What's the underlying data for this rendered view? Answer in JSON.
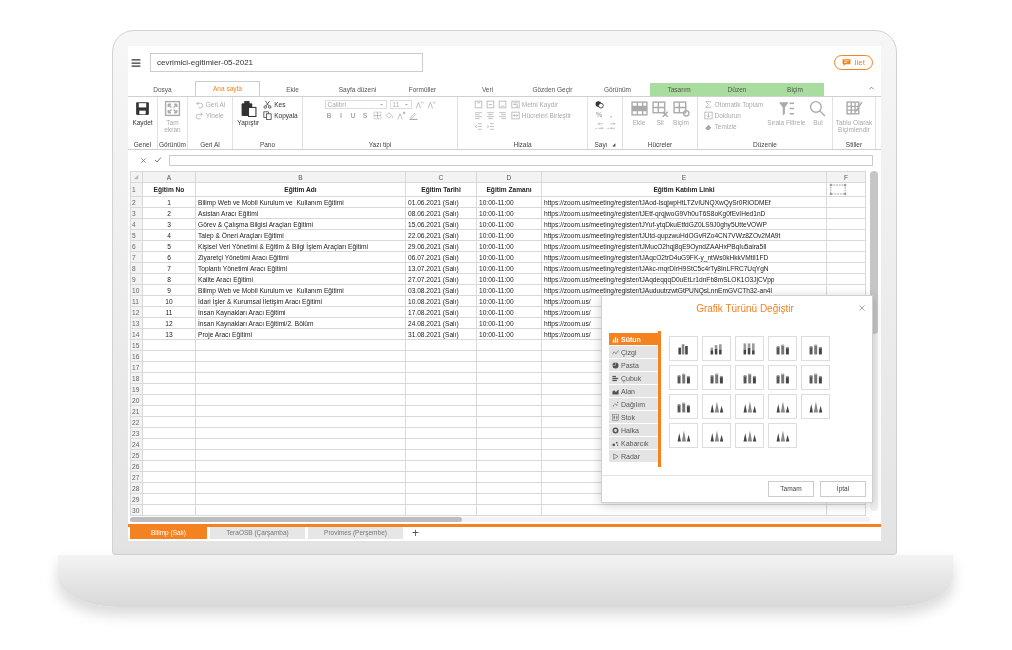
{
  "top_bar": {
    "file_name": "cevrimici-egitimler-05-2021",
    "feedback_button": "İlet"
  },
  "ribbon_tabs": [
    {
      "label": "Dosya",
      "selected": false,
      "kind": "standard"
    },
    {
      "label": "Ana sayfa",
      "selected": true,
      "kind": "standard"
    },
    {
      "label": "Ekle",
      "selected": false,
      "kind": "standard"
    },
    {
      "label": "Sayfa düzeni",
      "selected": false,
      "kind": "standard"
    },
    {
      "label": "Formüller",
      "selected": false,
      "kind": "standard"
    },
    {
      "label": "Veri",
      "selected": false,
      "kind": "standard"
    },
    {
      "label": "Gözden Geçir",
      "selected": false,
      "kind": "standard"
    },
    {
      "label": "Görünüm",
      "selected": false,
      "kind": "standard"
    },
    {
      "label": "Tasarım",
      "selected": false,
      "kind": "contextual"
    },
    {
      "label": "Düzen",
      "selected": false,
      "kind": "contextual"
    },
    {
      "label": "Biçim",
      "selected": false,
      "kind": "contextual"
    }
  ],
  "ribbon": {
    "groups": [
      {
        "label": "Genel",
        "columns": [
          [
            [
              {
                "kind": "large",
                "label": "Kaydet",
                "disabled": false
              }
            ]
          ]
        ]
      },
      {
        "label": "Görünüm",
        "columns": [
          [
            [
              {
                "kind": "large",
                "label": "Tam ekran",
                "disabled": true
              }
            ]
          ]
        ]
      },
      {
        "label": "Geri Al",
        "columns": [
          [
            [
              {
                "kind": "small",
                "label": "Geri Al",
                "disabled": true
              }
            ],
            [
              {
                "kind": "small",
                "label": "Yinele",
                "disabled": true
              }
            ]
          ]
        ]
      },
      {
        "label": "Pano",
        "columns": [
          [
            [
              {
                "kind": "large",
                "label": "Yapıştır",
                "disabled": false
              }
            ]
          ],
          [
            [
              {
                "kind": "small",
                "label": "Kes",
                "disabled": false
              }
            ],
            [
              {
                "kind": "small",
                "label": "Kopyala",
                "disabled": false
              }
            ]
          ]
        ]
      },
      {
        "label": "Yazı tipi",
        "columns": [
          [
            [
              {
                "kind": "dropdown",
                "label": "Calibri",
                "disabled": true
              },
              {
                "kind": "dropdown",
                "label": "11",
                "disabled": true
              },
              {
                "kind": "icon",
                "disabled": true
              },
              {
                "kind": "icon",
                "disabled": true
              }
            ],
            [
              {
                "kind": "glyph",
                "label": "B",
                "disabled": true
              },
              {
                "kind": "glyph",
                "label": "I",
                "disabled": true
              },
              {
                "kind": "glyph",
                "label": "U",
                "disabled": true
              },
              {
                "kind": "glyph",
                "label": "S",
                "disabled": true
              },
              {
                "kind": "icon",
                "disabled": true
              },
              {
                "kind": "icon",
                "disabled": true
              },
              {
                "kind": "icon",
                "disabled": true
              },
              {
                "kind": "icon",
                "disabled": true
              }
            ]
          ]
        ]
      },
      {
        "label": "Hizala",
        "columns": [
          [
            [
              {
                "kind": "icon",
                "disabled": true
              },
              {
                "kind": "icon",
                "disabled": true
              },
              {
                "kind": "icon",
                "disabled": true
              }
            ],
            [
              {
                "kind": "icon",
                "disabled": true
              },
              {
                "kind": "icon",
                "disabled": true
              },
              {
                "kind": "icon",
                "disabled": true
              }
            ],
            [
              {
                "kind": "icon",
                "disabled": true
              },
              {
                "kind": "icon",
                "disabled": true
              }
            ]
          ],
          [
            [
              {
                "kind": "small",
                "label": "Metni Kaydır",
                "disabled": true
              }
            ],
            [
              {
                "kind": "small",
                "label": "Hücreleri Birleştir",
                "disabled": true
              }
            ]
          ]
        ]
      },
      {
        "label": "Sayı",
        "launcher": true,
        "columns": [
          [
            [
              {
                "kind": "icon",
                "disabled": false
              }
            ],
            [
              {
                "kind": "glyph",
                "label": "%",
                "disabled": true
              },
              {
                "kind": "glyph",
                "label": ",",
                "disabled": true
              }
            ],
            [
              {
                "kind": "icon",
                "disabled": true
              },
              {
                "kind": "icon",
                "disabled": true
              }
            ]
          ]
        ]
      },
      {
        "label": "Hücreler",
        "columns": [
          [
            [
              {
                "kind": "large",
                "label": "Ekle",
                "disabled": true
              }
            ]
          ],
          [
            [
              {
                "kind": "large",
                "label": "Sil",
                "disabled": true
              }
            ]
          ],
          [
            [
              {
                "kind": "large",
                "label": "Biçim",
                "disabled": true
              }
            ]
          ]
        ]
      },
      {
        "label": "Düzenle",
        "columns": [
          [
            [
              {
                "kind": "small",
                "label": "Otomatik Toplam",
                "disabled": true
              }
            ],
            [
              {
                "kind": "small",
                "label": "Doldurun",
                "disabled": true
              }
            ],
            [
              {
                "kind": "small",
                "label": "Temizle",
                "disabled": true
              }
            ]
          ],
          [
            [
              {
                "kind": "large",
                "label": "Sırala Filtrele",
                "disabled": true
              }
            ]
          ],
          [
            [
              {
                "kind": "large",
                "label": "Bul",
                "disabled": true
              }
            ]
          ]
        ]
      },
      {
        "label": "Stiller",
        "columns": [
          [
            [
              {
                "kind": "large",
                "label": "Tablo Olarak Biçimlendir",
                "disabled": true
              }
            ]
          ]
        ]
      }
    ]
  },
  "sheet": {
    "columns": [
      "A",
      "B",
      "C",
      "D",
      "E",
      "F"
    ],
    "rows": [
      {
        "number": "1",
        "kind": "header",
        "cells": [
          "Eğitim No",
          "Eğitim Adı",
          "Eğitim Tarihi",
          "Eğitim Zamanı",
          "Eğitim Katılım Linki"
        ]
      },
      {
        "number": "2",
        "kind": "data",
        "cells": [
          "1",
          "Bilimp Web ve Mobil Kurulum ve  Kullanım Eğitimi",
          "01.06.2021 (Salı)",
          "10:00-11:00",
          "https://zoom.us/meeting/register/tJAod-lsqjwpHtLTZvIUNQXwQySr0RIODMEf"
        ]
      },
      {
        "number": "3",
        "kind": "data",
        "cells": [
          "2",
          "Asistan Aracı Eğitimi",
          "08.06.2021 (Salı)",
          "10:00-11:00",
          "https://zoom.us/meeting/register/tJEtf-qrqjwoG9Vh0uT6S8oKg0fEvIHed1nD"
        ]
      },
      {
        "number": "4",
        "kind": "data",
        "cells": [
          "3",
          "Görev & Çalışma Bilgisi Araçları Eğitimi",
          "15.06.2021 (Salı)",
          "10:00-11:00",
          "https://zoom.us/meeting/register/tJYuf-ytqDkuEtfdGZ0LS9J0ghy5UtteVOWP"
        ]
      },
      {
        "number": "5",
        "kind": "data",
        "cells": [
          "4",
          "Talep & Öneri Araçları Eğitimi",
          "22.06.2021 (Salı)",
          "10:00-11:00",
          "https://zoom.us/meeting/register/tJUtd-qupzwuHdOGvRZo4CN7VWz8ZOv2MA9t"
        ]
      },
      {
        "number": "6",
        "kind": "data",
        "cells": [
          "5",
          "Kişisel Veri Yönetimi & Eğitim & Bilgi İşlem Araçları Eğitimi",
          "29.06.2021 (Salı)",
          "10:00-11:00",
          "https://zoom.us/meeting/register/tJMucO2hqj8qE9OyndZAAHxPBqIu5aira5Il"
        ]
      },
      {
        "number": "7",
        "kind": "data",
        "cells": [
          "6",
          "Ziyaretçi Yönetimi Aracı Eğitimi",
          "06.07.2021 (Salı)",
          "10:00-11:00",
          "https://zoom.us/meeting/register/tJAqcO2trD4uG9FK-y_ntWs0kHkkVMtlI1FD"
        ]
      },
      {
        "number": "8",
        "kind": "data",
        "cells": [
          "7",
          "Toplantı Yönetimi Aracı Eğitimi",
          "13.07.2021 (Salı)",
          "10:00-11:00",
          "https://zoom.us/meeting/register/tJAkc-mqrDIrH9StC5c4rTy8InLFRC7UqYgN"
        ]
      },
      {
        "number": "9",
        "kind": "data",
        "cells": [
          "8",
          "Kalite Aracı Eğitimi",
          "27.07.2021 (Salı)",
          "10:00-11:00",
          "https://zoom.us/meeting/register/tJAqdeqqqD0uEtLr1dnFb8mSLOK1O3JjCVpp"
        ]
      },
      {
        "number": "10",
        "kind": "data",
        "cells": [
          "9",
          "Bilimp Web ve Mobil Kurulum ve  Kullanım Eğitimi",
          "03.08.2021 (Salı)",
          "10:00-11:00",
          "https://zoom.us/meeting/register/tJAuduutrzwtGtPUNQsLnnEmGVCTh32-an4l"
        ]
      },
      {
        "number": "11",
        "kind": "data",
        "cells": [
          "10",
          "İdari İşler & Kurumsal İletişim Aracı Eğitimi",
          "10.08.2021 (Salı)",
          "10:00-11:00",
          "https://zoom.us/"
        ]
      },
      {
        "number": "12",
        "kind": "data",
        "cells": [
          "11",
          "İnsan Kaynakları Aracı Eğitimi",
          "17.08.2021 (Salı)",
          "10:00-11:00",
          "https://zoom.us/"
        ]
      },
      {
        "number": "13",
        "kind": "data",
        "cells": [
          "12",
          "İnsan Kaynakları Aracı Eğitimi/2. Bölüm",
          "24.08.2021 (Salı)",
          "10:00-11:00",
          "https://zoom.us/"
        ]
      },
      {
        "number": "14",
        "kind": "data",
        "cells": [
          "13",
          "Proje Aracı Eğitimi",
          "31.08.2021 (Salı)",
          "10:00-11:00",
          "https://zoom.us/"
        ]
      },
      {
        "number": "15"
      },
      {
        "number": "16"
      },
      {
        "number": "17"
      },
      {
        "number": "18"
      },
      {
        "number": "19"
      },
      {
        "number": "20"
      },
      {
        "number": "21"
      },
      {
        "number": "22"
      },
      {
        "number": "23"
      },
      {
        "number": "24"
      },
      {
        "number": "25"
      },
      {
        "number": "26"
      },
      {
        "number": "27"
      },
      {
        "number": "28"
      },
      {
        "number": "29"
      },
      {
        "number": "30"
      }
    ]
  },
  "chart_dialog": {
    "title": "Grafik Türünü Değiştir",
    "types": [
      {
        "kind": "column",
        "label": "Sütun",
        "selected": true
      },
      {
        "kind": "line",
        "label": "Çizgi",
        "selected": false
      },
      {
        "kind": "pie",
        "label": "Pasta",
        "selected": false
      },
      {
        "kind": "bar",
        "label": "Çubuk",
        "selected": false
      },
      {
        "kind": "area",
        "label": "Alan",
        "selected": false
      },
      {
        "kind": "scatter",
        "label": "Dağılım",
        "selected": false
      },
      {
        "kind": "stock",
        "label": "Stok",
        "selected": false
      },
      {
        "kind": "donut",
        "label": "Halka",
        "selected": false
      },
      {
        "kind": "bubble",
        "label": "Kabarcık",
        "selected": false
      },
      {
        "kind": "radar",
        "label": "Radar",
        "selected": false
      }
    ],
    "styles": [
      {
        "kind": "clustered"
      },
      {
        "kind": "stacked"
      },
      {
        "kind": "full"
      },
      {
        "kind": "cylinder"
      },
      {
        "kind": "cylinder"
      },
      {
        "kind": "cylinder"
      },
      {
        "kind": "cylinder"
      },
      {
        "kind": "cylinder"
      },
      {
        "kind": "cylinder"
      },
      {
        "kind": "cylinder"
      },
      {
        "kind": "cylinder"
      },
      {
        "kind": "cone"
      },
      {
        "kind": "cone"
      },
      {
        "kind": "cone"
      },
      {
        "kind": "cone"
      },
      {
        "kind": "cone"
      },
      {
        "kind": "cone"
      },
      {
        "kind": "cone"
      },
      {
        "kind": "cone"
      }
    ],
    "buttons": [
      "Tamam",
      "İptal"
    ]
  },
  "sheet_tabs": [
    {
      "label": "Bilimp (Salı)",
      "selected": true
    },
    {
      "label": "TeraOSB (Çarşamba)",
      "selected": false
    },
    {
      "label": "Provimes (Perşembe)",
      "selected": false
    }
  ],
  "add_sheet": "+"
}
